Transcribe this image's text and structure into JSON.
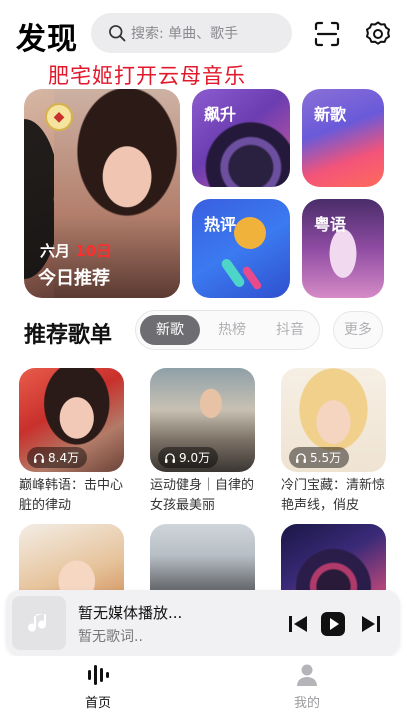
{
  "header": {
    "title": "发现",
    "search_placeholder": "搜索: 单曲、歌手"
  },
  "banner_text": "肥宅姬打开云母音乐",
  "featured": {
    "daily": {
      "month": "六月",
      "day": "10日",
      "label": "今日推荐"
    },
    "rising": "飙升",
    "new_songs": "新歌",
    "hot_comments": "热评",
    "cantonese": "粤语"
  },
  "playlists_section": {
    "title": "推荐歌单",
    "tabs": [
      "新歌",
      "热榜",
      "抖音"
    ],
    "active_tab": "新歌",
    "more": "更多"
  },
  "playlists": [
    {
      "plays": "8.4万",
      "name": "巅峰韩语：击中心脏的律动"
    },
    {
      "plays": "9.0万",
      "name": "运动健身｜自律的女孩最美丽"
    },
    {
      "plays": "5.5万",
      "name": "冷门宝藏：清新惊艳声线，俏皮"
    },
    {
      "plays": "",
      "name": ""
    },
    {
      "plays": "",
      "name": ""
    },
    {
      "plays": "",
      "name": ""
    }
  ],
  "player": {
    "song": "暂无媒体播放...",
    "lyric": "暂无歌词.."
  },
  "nav": {
    "home": "首页",
    "me": "我的"
  },
  "colors": {
    "banner_red": "#e2182b",
    "tab_active": "#6e6e72"
  }
}
